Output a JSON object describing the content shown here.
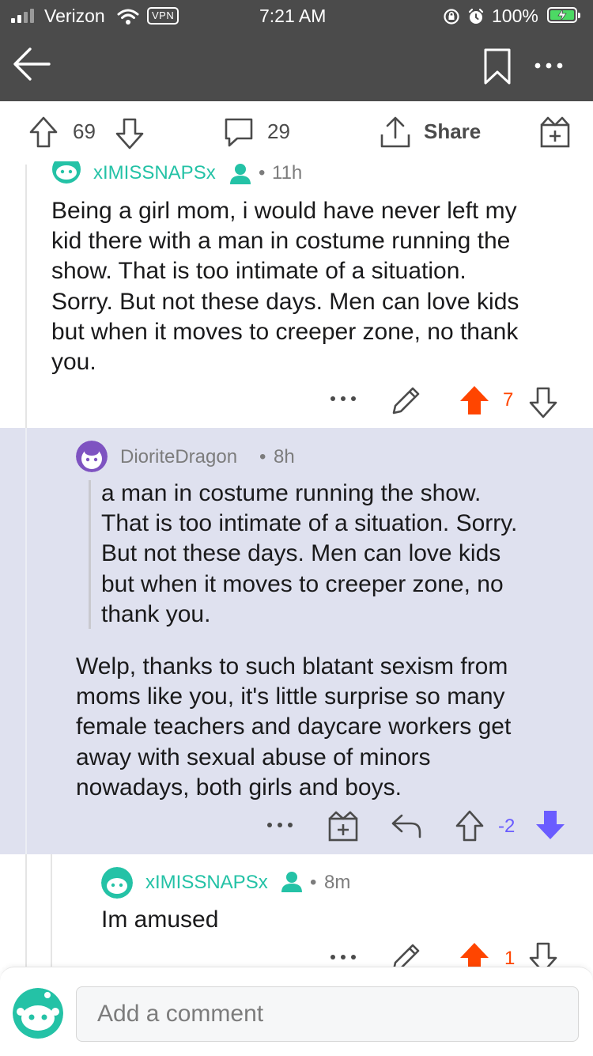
{
  "status_bar": {
    "carrier": "Verizon",
    "vpn": "VPN",
    "time": "7:21 AM",
    "battery": "100%",
    "icons": [
      "signal-icon",
      "wifi-icon",
      "orientation-lock-icon",
      "alarm-icon",
      "battery-charging-icon"
    ]
  },
  "header": {
    "icons": [
      "back-arrow-icon",
      "bookmark-icon",
      "more-options-icon"
    ]
  },
  "post_actions": {
    "votes": "69",
    "comments": "29",
    "share_label": "Share",
    "icons": [
      "upvote-icon",
      "downvote-icon",
      "comment-icon",
      "share-icon",
      "award-icon"
    ]
  },
  "comments": [
    {
      "username": "xIMISSNAPSx",
      "time": "11h",
      "body": "Being a girl mom, i would have never left my\nkid there with a man in costume running the\nshow. That is too intimate of a situation.\nSorry. But not these days. Men can love kids\nbut when it moves to creeper zone, no thank\nyou.",
      "score": "7",
      "vote_state": "upvoted"
    },
    {
      "username": "DioriteDragon",
      "time": "8h",
      "quote": "a man in costume running the show.\nThat is too intimate of a situation. Sorry.\nBut not these days. Men can love kids\nbut when it moves to creeper zone, no\nthank you.",
      "body": "Welp, thanks to such blatant sexism from\nmoms like you, it's little surprise so many\nfemale teachers and daycare workers get\naway with sexual abuse of minors\nnowadays, both girls and boys.",
      "score": "-2",
      "vote_state": "downvoted"
    },
    {
      "username": "xIMISSNAPSx",
      "time": "8m",
      "body": "Im amused",
      "score": "1",
      "vote_state": "upvoted"
    }
  ],
  "composer": {
    "placeholder": "Add a comment"
  },
  "colors": {
    "header_bg": "#4b4b4b",
    "op_teal": "#24c2a6",
    "upvote_orange": "#ff4500",
    "downvote_purple": "#6a5cff",
    "highlight_bg": "#dfe1ef"
  }
}
